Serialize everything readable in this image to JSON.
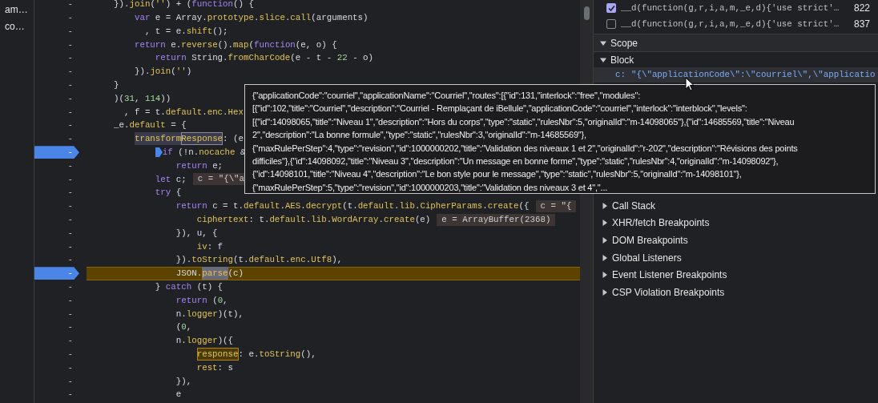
{
  "sidebar": {
    "items": [
      {
        "label": "am…"
      },
      {
        "label": "co…"
      }
    ]
  },
  "editor": {
    "lines": [
      {
        "gutter": "-",
        "breakpoint": false,
        "paused": false,
        "tokens": [
          {
            "kind": "plain",
            "text": "})."
          },
          {
            "kind": "prop",
            "text": "join"
          },
          {
            "kind": "plain",
            "text": "("
          },
          {
            "kind": "str",
            "text": "''"
          },
          {
            "kind": "plain",
            "text": ") + ("
          },
          {
            "kind": "kw",
            "text": "function"
          },
          {
            "kind": "plain",
            "text": "() {"
          }
        ]
      },
      {
        "gutter": "-",
        "breakpoint": false,
        "paused": false,
        "tokens": [
          {
            "kind": "kw",
            "text": "    var"
          },
          {
            "kind": "plain",
            "text": " e = Array."
          },
          {
            "kind": "prop",
            "text": "prototype"
          },
          {
            "kind": "plain",
            "text": "."
          },
          {
            "kind": "prop",
            "text": "slice"
          },
          {
            "kind": "plain",
            "text": "."
          },
          {
            "kind": "prop",
            "text": "call"
          },
          {
            "kind": "plain",
            "text": "(arguments)"
          }
        ]
      },
      {
        "gutter": "-",
        "breakpoint": false,
        "paused": false,
        "tokens": [
          {
            "kind": "plain",
            "text": "      , t = e."
          },
          {
            "kind": "prop",
            "text": "shift"
          },
          {
            "kind": "plain",
            "text": "();"
          }
        ]
      },
      {
        "gutter": "-",
        "breakpoint": false,
        "paused": false,
        "tokens": [
          {
            "kind": "kw",
            "text": "    return"
          },
          {
            "kind": "plain",
            "text": " e."
          },
          {
            "kind": "prop",
            "text": "reverse"
          },
          {
            "kind": "plain",
            "text": "()."
          },
          {
            "kind": "prop",
            "text": "map"
          },
          {
            "kind": "plain",
            "text": "("
          },
          {
            "kind": "kw",
            "text": "function"
          },
          {
            "kind": "plain",
            "text": "(e, o) {"
          }
        ]
      },
      {
        "gutter": "-",
        "breakpoint": false,
        "paused": false,
        "tokens": [
          {
            "kind": "kw",
            "text": "        return"
          },
          {
            "kind": "plain",
            "text": " String."
          },
          {
            "kind": "prop",
            "text": "fromCharCode"
          },
          {
            "kind": "plain",
            "text": "(e - t - "
          },
          {
            "kind": "num",
            "text": "22"
          },
          {
            "kind": "plain",
            "text": " - o)"
          }
        ]
      },
      {
        "gutter": "-",
        "breakpoint": false,
        "paused": false,
        "tokens": [
          {
            "kind": "plain",
            "text": "    })."
          },
          {
            "kind": "prop",
            "text": "join"
          },
          {
            "kind": "plain",
            "text": "("
          },
          {
            "kind": "str",
            "text": "''"
          },
          {
            "kind": "plain",
            "text": ")"
          }
        ]
      },
      {
        "gutter": "-",
        "breakpoint": false,
        "paused": false,
        "tokens": [
          {
            "kind": "plain",
            "text": "}"
          }
        ]
      },
      {
        "gutter": "-",
        "breakpoint": false,
        "paused": false,
        "tokens": [
          {
            "kind": "plain",
            "text": ")("
          },
          {
            "kind": "num",
            "text": "31"
          },
          {
            "kind": "plain",
            "text": ", "
          },
          {
            "kind": "num",
            "text": "114"
          },
          {
            "kind": "plain",
            "text": "))"
          }
        ]
      },
      {
        "gutter": "-",
        "breakpoint": false,
        "paused": false,
        "tokens": [
          {
            "kind": "plain",
            "text": "  , f = t."
          },
          {
            "kind": "prop",
            "text": "default"
          },
          {
            "kind": "plain",
            "text": "."
          },
          {
            "kind": "prop",
            "text": "enc"
          },
          {
            "kind": "plain",
            "text": "."
          },
          {
            "kind": "prop",
            "text": "Hex"
          }
        ]
      },
      {
        "gutter": "-",
        "breakpoint": false,
        "paused": false,
        "tokens": [
          {
            "kind": "plain",
            "text": "_e."
          },
          {
            "kind": "prop",
            "text": "default"
          },
          {
            "kind": "plain",
            "text": " = {"
          }
        ]
      },
      {
        "gutter": "-",
        "breakpoint": false,
        "paused": false,
        "tokens": [
          {
            "kind": "highlight",
            "text": "    transform"
          },
          {
            "kind": "match",
            "text": "Response"
          },
          {
            "kind": "plain",
            "text": ": (e"
          }
        ]
      },
      {
        "gutter": "-",
        "breakpoint": true,
        "paused": false,
        "inline_breakpoint": true,
        "tokens": [
          {
            "kind": "kw",
            "text": "        if"
          },
          {
            "kind": "plain",
            "text": " (!n."
          },
          {
            "kind": "prop",
            "text": "nocache"
          },
          {
            "kind": "plain",
            "text": " &"
          }
        ]
      },
      {
        "gutter": "-",
        "breakpoint": false,
        "paused": false,
        "tokens": [
          {
            "kind": "kw",
            "text": "            return"
          },
          {
            "kind": "plain",
            "text": " e;"
          }
        ]
      },
      {
        "gutter": "-",
        "breakpoint": false,
        "paused": false,
        "inline_value": "c = \"{\\\"a",
        "tokens": [
          {
            "kind": "kw",
            "text": "        let"
          },
          {
            "kind": "plain",
            "text": " c;"
          }
        ]
      },
      {
        "gutter": "-",
        "breakpoint": false,
        "paused": false,
        "tokens": [
          {
            "kind": "kw",
            "text": "        try"
          },
          {
            "kind": "plain",
            "text": " {"
          }
        ]
      },
      {
        "gutter": "-",
        "breakpoint": false,
        "paused": false,
        "inline_value": "c = \"{",
        "tokens": [
          {
            "kind": "kw",
            "text": "            return"
          },
          {
            "kind": "plain",
            "text": " c = t."
          },
          {
            "kind": "prop",
            "text": "default"
          },
          {
            "kind": "plain",
            "text": "."
          },
          {
            "kind": "prop",
            "text": "AES"
          },
          {
            "kind": "plain",
            "text": "."
          },
          {
            "kind": "prop",
            "text": "decrypt"
          },
          {
            "kind": "plain",
            "text": "(t."
          },
          {
            "kind": "prop",
            "text": "default"
          },
          {
            "kind": "plain",
            "text": "."
          },
          {
            "kind": "prop",
            "text": "lib"
          },
          {
            "kind": "plain",
            "text": "."
          },
          {
            "kind": "prop",
            "text": "CipherParams"
          },
          {
            "kind": "plain",
            "text": "."
          },
          {
            "kind": "prop",
            "text": "create"
          },
          {
            "kind": "plain",
            "text": "({"
          }
        ]
      },
      {
        "gutter": "-",
        "breakpoint": false,
        "paused": false,
        "inline_value": "e = ArrayBuffer(2368)",
        "tokens": [
          {
            "kind": "prop",
            "text": "                ciphertext"
          },
          {
            "kind": "plain",
            "text": ": t."
          },
          {
            "kind": "prop",
            "text": "default"
          },
          {
            "kind": "plain",
            "text": "."
          },
          {
            "kind": "prop",
            "text": "lib"
          },
          {
            "kind": "plain",
            "text": "."
          },
          {
            "kind": "prop",
            "text": "WordArray"
          },
          {
            "kind": "plain",
            "text": "."
          },
          {
            "kind": "prop",
            "text": "create"
          },
          {
            "kind": "plain",
            "text": "(e)"
          }
        ]
      },
      {
        "gutter": "-",
        "breakpoint": false,
        "paused": false,
        "tokens": [
          {
            "kind": "plain",
            "text": "            }), u, {"
          }
        ]
      },
      {
        "gutter": "-",
        "breakpoint": false,
        "paused": false,
        "tokens": [
          {
            "kind": "prop",
            "text": "                iv"
          },
          {
            "kind": "plain",
            "text": ": f"
          }
        ]
      },
      {
        "gutter": "-",
        "breakpoint": false,
        "paused": false,
        "tokens": [
          {
            "kind": "plain",
            "text": "            })."
          },
          {
            "kind": "prop",
            "text": "toString"
          },
          {
            "kind": "plain",
            "text": "(t."
          },
          {
            "kind": "prop",
            "text": "default"
          },
          {
            "kind": "plain",
            "text": "."
          },
          {
            "kind": "prop",
            "text": "enc"
          },
          {
            "kind": "plain",
            "text": "."
          },
          {
            "kind": "prop",
            "text": "Utf8"
          },
          {
            "kind": "plain",
            "text": "),"
          }
        ]
      },
      {
        "gutter": "-",
        "breakpoint": true,
        "paused": true,
        "tokens": [
          {
            "kind": "plain",
            "text": "            JSON."
          },
          {
            "kind": "search",
            "text": "parse"
          },
          {
            "kind": "plain",
            "text": "(c)"
          }
        ]
      },
      {
        "gutter": "-",
        "breakpoint": false,
        "paused": false,
        "tokens": [
          {
            "kind": "plain",
            "text": "        } "
          },
          {
            "kind": "kw",
            "text": "catch"
          },
          {
            "kind": "plain",
            "text": " (t) {"
          }
        ]
      },
      {
        "gutter": "-",
        "breakpoint": false,
        "paused": false,
        "tokens": [
          {
            "kind": "kw",
            "text": "            return"
          },
          {
            "kind": "plain",
            "text": " ("
          },
          {
            "kind": "num",
            "text": "0"
          },
          {
            "kind": "plain",
            "text": ","
          }
        ]
      },
      {
        "gutter": "-",
        "breakpoint": false,
        "paused": false,
        "tokens": [
          {
            "kind": "plain",
            "text": "            n."
          },
          {
            "kind": "prop",
            "text": "logger"
          },
          {
            "kind": "plain",
            "text": ")(t),"
          }
        ]
      },
      {
        "gutter": "-",
        "breakpoint": false,
        "paused": false,
        "tokens": [
          {
            "kind": "plain",
            "text": "            ("
          },
          {
            "kind": "num",
            "text": "0"
          },
          {
            "kind": "plain",
            "text": ","
          }
        ]
      },
      {
        "gutter": "-",
        "breakpoint": false,
        "paused": false,
        "tokens": [
          {
            "kind": "plain",
            "text": "            n."
          },
          {
            "kind": "prop",
            "text": "logger"
          },
          {
            "kind": "plain",
            "text": ")({"
          }
        ]
      },
      {
        "gutter": "-",
        "breakpoint": false,
        "paused": false,
        "tokens": [
          {
            "kind": "current",
            "text": "                response"
          },
          {
            "kind": "plain",
            "text": ": e."
          },
          {
            "kind": "prop",
            "text": "toString"
          },
          {
            "kind": "plain",
            "text": "(),"
          }
        ]
      },
      {
        "gutter": "-",
        "breakpoint": false,
        "paused": false,
        "tokens": [
          {
            "kind": "prop",
            "text": "                rest"
          },
          {
            "kind": "plain",
            "text": ": s"
          }
        ]
      },
      {
        "gutter": "-",
        "breakpoint": false,
        "paused": false,
        "tokens": [
          {
            "kind": "plain",
            "text": "            }),"
          }
        ]
      },
      {
        "gutter": "-",
        "breakpoint": false,
        "paused": false,
        "tokens": [
          {
            "kind": "plain",
            "text": "            e"
          }
        ]
      }
    ]
  },
  "breakpoints": [
    {
      "label": "__d(function(g,r,i,a,m,_e,d){'use strict'…",
      "line": "822",
      "checked": true
    },
    {
      "label": "__d(function(g,r,i,a,m,_e,d){'use strict'…",
      "line": "837",
      "checked": false
    }
  ],
  "scope": {
    "label": "Scope",
    "expanded": true,
    "block": {
      "label": "Block",
      "expanded": true,
      "variable": {
        "name": "c:",
        "value": "\"{\\\"applicationCode\\\":\\\"courriel\\\",\\\"applicatio"
      }
    }
  },
  "sections": [
    {
      "label": "Call Stack",
      "expanded": false
    },
    {
      "label": "XHR/fetch Breakpoints",
      "expanded": false
    },
    {
      "label": "DOM Breakpoints",
      "expanded": false
    },
    {
      "label": "Global Listeners",
      "expanded": false
    },
    {
      "label": "Event Listener Breakpoints",
      "expanded": false
    },
    {
      "label": "CSP Violation Breakpoints",
      "expanded": false
    }
  ],
  "tooltip": {
    "lines": [
      "{\"applicationCode\":\"courriel\",\"applicationName\":\"Courriel\",\"routes\":[{\"id\":131,\"interlock\":\"free\",\"modules\":",
      "[{\"id\":102,\"title\":\"Courriel\",\"description\":\"Courriel - Remplaçant de iBellule\",\"applicationCode\":\"courriel\",\"interlock\":\"interblock\",\"levels\":",
      "[{\"id\":14098065,\"title\":\"Niveau 1\",\"description\":\"Hors du corps\",\"type\":\"static\",\"rulesNbr\":5,\"originalId\":\"m-14098065\"},{\"id\":14685569,\"title\":\"Niveau",
      "2\",\"description\":\"La bonne formule\",\"type\":\"static\",\"rulesNbr\":3,\"originalId\":\"m-14685569\"},",
      "{\"maxRulePerStep\":4,\"type\":\"revision\",\"id\":1000000202,\"title\":\"Validation des niveaux 1 et 2\",\"originalId\":\"r-202\",\"description\":\"Révisions des points",
      "difficiles\"},{\"id\":14098092,\"title\":\"Niveau 3\",\"description\":\"Un message en bonne forme\",\"type\":\"static\",\"rulesNbr\":4,\"originalId\":\"m-14098092\"},",
      "{\"id\":14098101,\"title\":\"Niveau 4\",\"description\":\"Le bon style pour le message\",\"type\":\"static\",\"rulesNbr\":5,\"originalId\":\"m-14098101\"},",
      "{\"maxRulePerStep\":5,\"type\":\"revision\",\"id\":1000000203,\"title\":\"Validation des niveaux 3 et 4\",\"..."
    ]
  }
}
